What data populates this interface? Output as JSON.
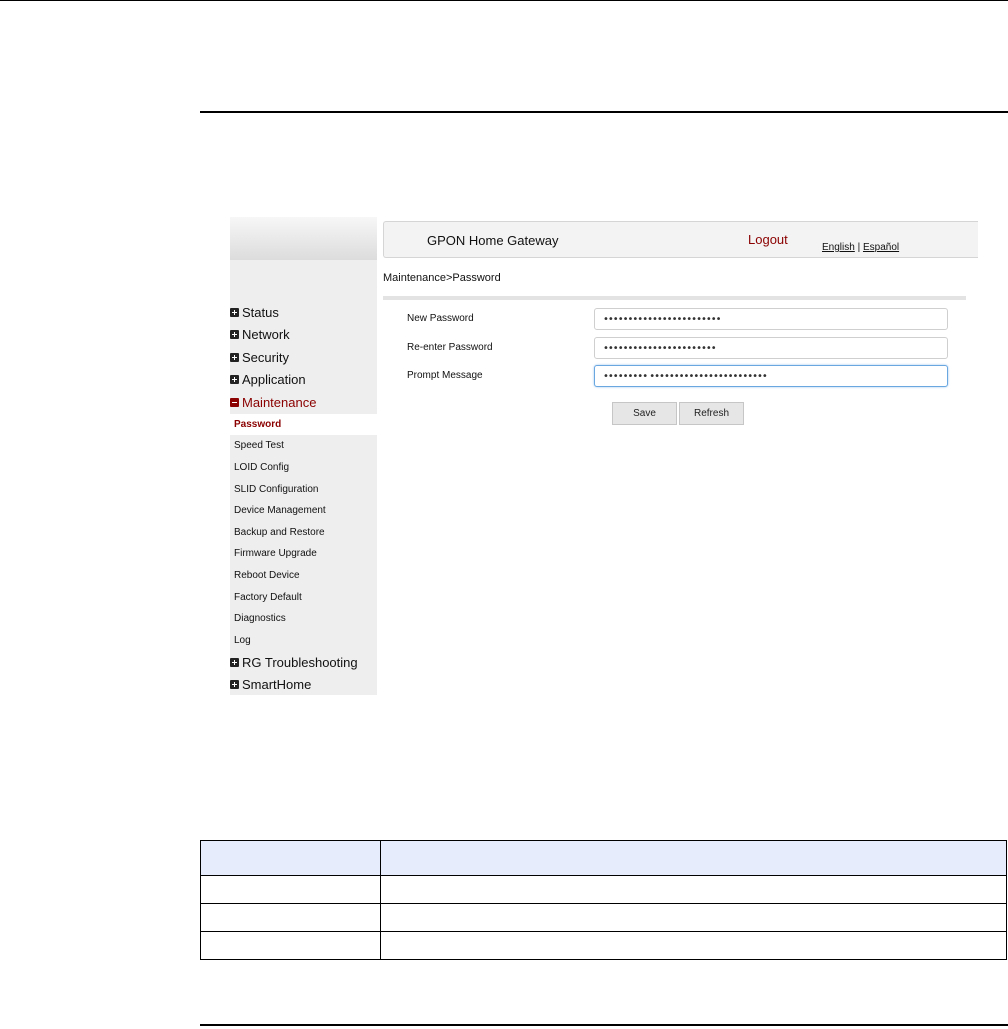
{
  "header": {
    "title": "GPON Home Gateway",
    "logout": "Logout",
    "lang_english": "English",
    "lang_sep": " | ",
    "lang_espanol": "Español"
  },
  "breadcrumb": "Maintenance>Password",
  "sidebar": {
    "menu_top": [
      {
        "label": "Status",
        "icon": "plus-icon"
      },
      {
        "label": "Network",
        "icon": "plus-icon"
      },
      {
        "label": "Security",
        "icon": "plus-icon"
      },
      {
        "label": "Application",
        "icon": "plus-icon"
      },
      {
        "label": "Maintenance",
        "icon": "minus-icon"
      }
    ],
    "submenu": [
      "Password",
      "Speed Test",
      "LOID Config",
      "SLID Configuration",
      "Device Management",
      "Backup and Restore",
      "Firmware Upgrade",
      "Reboot Device",
      "Factory Default",
      "Diagnostics",
      "Log"
    ],
    "menu_bottom": [
      {
        "label": "RG Troubleshooting",
        "icon": "plus-icon"
      },
      {
        "label": "SmartHome",
        "icon": "plus-icon"
      }
    ]
  },
  "form": {
    "new_password_label": "New Password",
    "new_password_value": "••••••••••••••••••••••••",
    "reenter_label": "Re-enter Password",
    "reenter_value": "•••••••••••••••••••••••",
    "prompt_label": "Prompt Message",
    "prompt_value": "••••••••• ••••••••••••••••••••••••",
    "save": "Save",
    "refresh": "Refresh"
  },
  "colors": {
    "accent": "#8b0000",
    "table_header": "#e6ecfb"
  }
}
